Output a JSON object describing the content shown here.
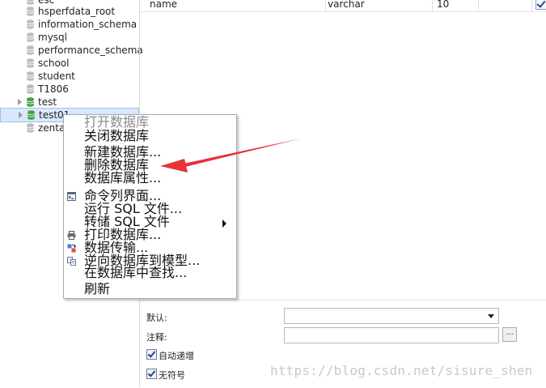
{
  "tree": {
    "items": [
      {
        "label": "esc",
        "expandable": false,
        "color": "grey"
      },
      {
        "label": "hsperfdata_root",
        "expandable": false,
        "color": "grey"
      },
      {
        "label": "information_schema",
        "expandable": false,
        "color": "grey"
      },
      {
        "label": "mysql",
        "expandable": false,
        "color": "grey"
      },
      {
        "label": "performance_schema",
        "expandable": false,
        "color": "grey"
      },
      {
        "label": "school",
        "expandable": false,
        "color": "grey"
      },
      {
        "label": "student",
        "expandable": false,
        "color": "grey"
      },
      {
        "label": "T1806",
        "expandable": false,
        "color": "grey"
      },
      {
        "label": "test",
        "expandable": true,
        "color": "green"
      },
      {
        "label": "test01",
        "expandable": true,
        "color": "green",
        "selected": true
      },
      {
        "label": "zentao",
        "expandable": false,
        "color": "grey"
      }
    ]
  },
  "grid": {
    "name": "name",
    "type": "varchar",
    "length": "10"
  },
  "menu": {
    "items": [
      {
        "label": "打开数据库",
        "disabled": true,
        "icon": ""
      },
      {
        "label": "关闭数据库",
        "disabled": false,
        "icon": ""
      },
      {
        "label": "新建数据库...",
        "disabled": false,
        "icon": ""
      },
      {
        "label": "删除数据库",
        "disabled": false,
        "icon": ""
      },
      {
        "label": "数据库属性...",
        "disabled": false,
        "icon": ""
      },
      {
        "label": "命令列界面...",
        "disabled": false,
        "icon": "console-icon"
      },
      {
        "label": "运行 SQL 文件...",
        "disabled": false,
        "icon": ""
      },
      {
        "label": "转储 SQL 文件",
        "disabled": false,
        "icon": "",
        "submenu": true
      },
      {
        "label": "打印数据库...",
        "disabled": false,
        "icon": "printer-icon"
      },
      {
        "label": "数据传输...",
        "disabled": false,
        "icon": "data-transfer-icon"
      },
      {
        "label": "逆向数据库到模型...",
        "disabled": false,
        "icon": "reverse-model-icon"
      },
      {
        "label": "在数据库中查找...",
        "disabled": false,
        "icon": ""
      },
      {
        "label": "刷新",
        "disabled": false,
        "icon": ""
      }
    ]
  },
  "props": {
    "default_label": "默认:",
    "comment_label": "注释:",
    "dots": "...",
    "auto_increment_label": "自动递增",
    "unsigned_label": "无符号"
  },
  "watermark": "https://blog.csdn.net/sisure_shen",
  "colors": {
    "arrow": "#e8323c",
    "db_grey": "#bdbdbd",
    "db_green": "#3fa33f",
    "selection": "#d9e8fb"
  }
}
